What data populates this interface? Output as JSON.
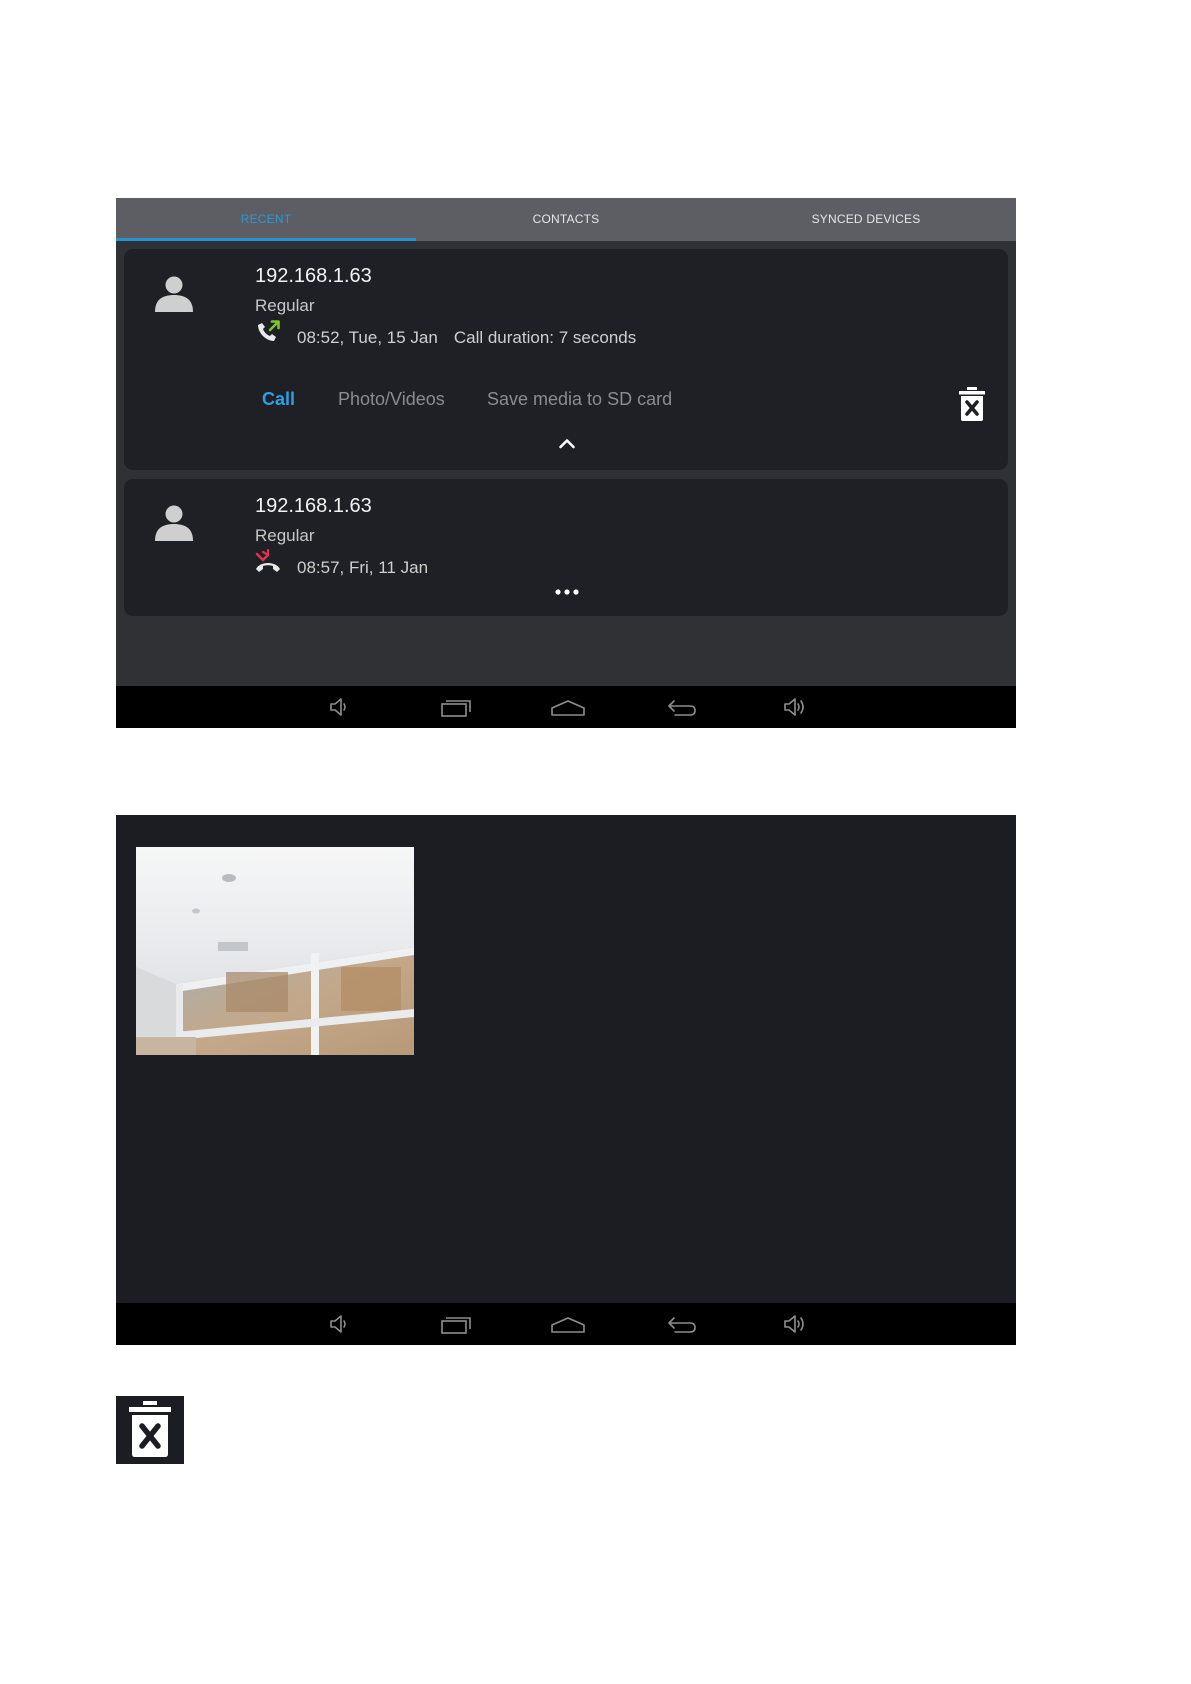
{
  "tabs": [
    {
      "label": "RECENT",
      "active": true
    },
    {
      "label": "CONTACTS",
      "active": false
    },
    {
      "label": "SYNCED DEVICES",
      "active": false
    }
  ],
  "calls": [
    {
      "name": "192.168.1.63",
      "type": "Regular",
      "direction": "outgoing",
      "icon": "outgoing-call-icon",
      "time": "08:52, Tue, 15 Jan",
      "duration": "Call duration: 7 seconds",
      "expanded": true,
      "actions": {
        "call": "Call",
        "photo_videos": "Photo/Videos",
        "save_media": "Save media to SD card"
      }
    },
    {
      "name": "192.168.1.63",
      "type": "Regular",
      "direction": "missed",
      "icon": "missed-call-icon",
      "time": "08:57, Fri, 11 Jan",
      "expanded": false
    }
  ],
  "nav_buttons": [
    "volume-down-icon",
    "recent-apps-icon",
    "home-icon",
    "back-icon",
    "volume-up-icon"
  ],
  "colors": {
    "accent": "#2d9fe6",
    "outgoing": "#7cc62b",
    "missed": "#e0304f",
    "card": "#1e2025"
  }
}
